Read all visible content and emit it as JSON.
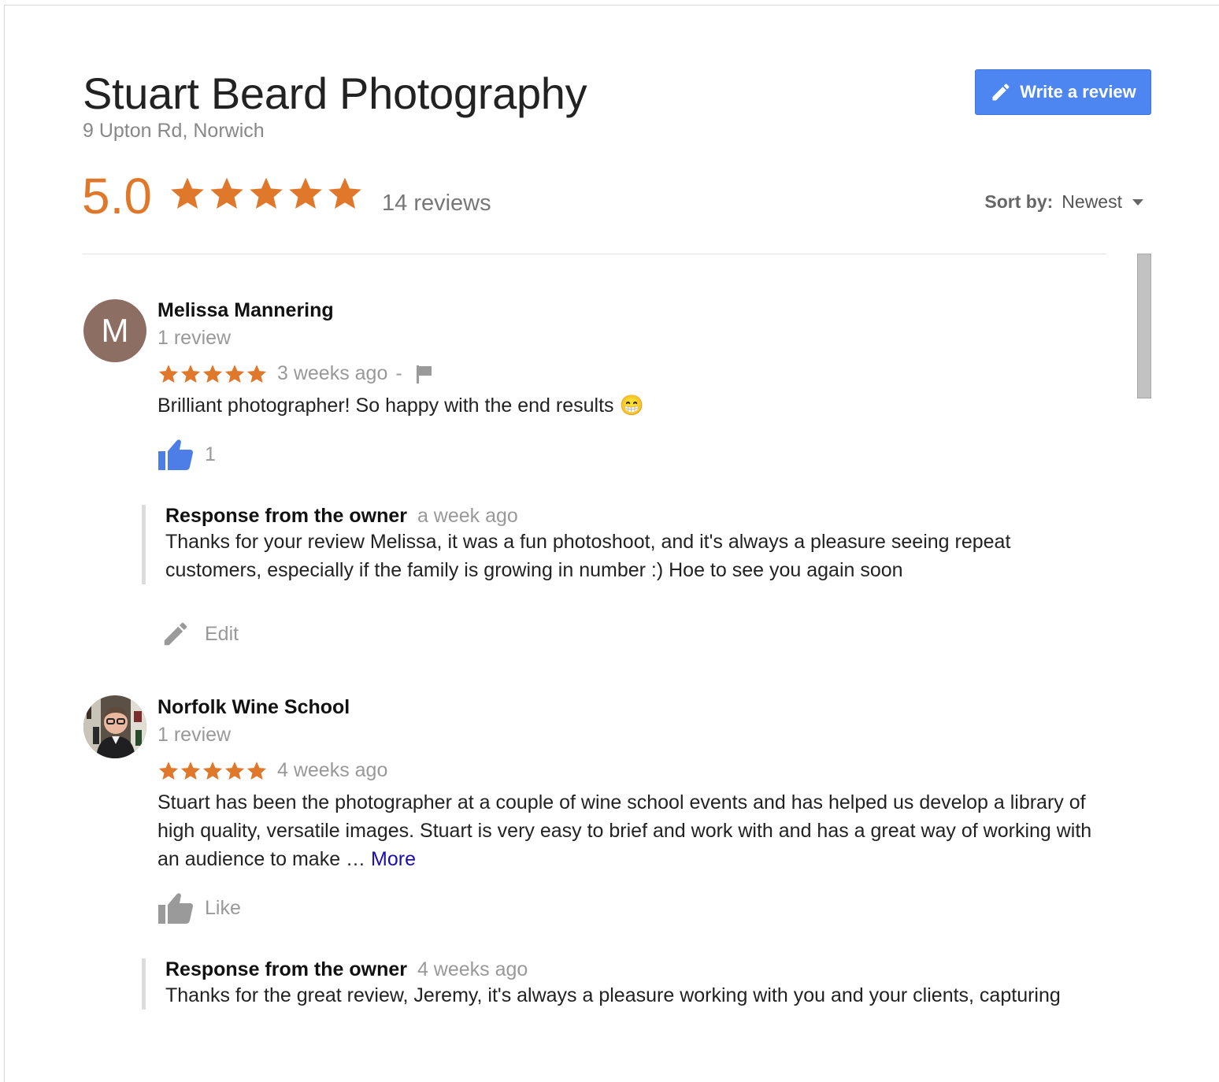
{
  "business": {
    "name": "Stuart Beard Photography",
    "address": "9 Upton Rd, Norwich"
  },
  "actions": {
    "write_review": "Write a review"
  },
  "summary": {
    "score": "5.0",
    "stars": 5,
    "review_count": "14 reviews"
  },
  "sort": {
    "label": "Sort by:",
    "value": "Newest"
  },
  "colors": {
    "star": "#e0782c",
    "accent": "#4d86f0",
    "link": "#1a0dab"
  },
  "reviews": [
    {
      "avatar_letter": "M",
      "author": "Melissa Mannering",
      "author_reviews": "1 review",
      "stars": 5,
      "time": "3 weeks ago",
      "separator": "-",
      "text": "Brilliant photographer! So happy with the end results 😁",
      "likes": "1",
      "owner_response": {
        "label": "Response from the owner",
        "time": "a week ago",
        "text": "Thanks for your review Melissa, it was a fun photoshoot, and it's always a pleasure seeing repeat customers, especially if the family is growing in number :) Hoe to see you again soon"
      },
      "edit_label": "Edit"
    },
    {
      "author": "Norfolk Wine School",
      "author_reviews": "1 review",
      "stars": 5,
      "time": "4 weeks ago",
      "text": "Stuart has been the photographer at a couple of wine school events and has helped us develop a library of high quality, versatile images. Stuart is very easy to brief and work with and has a great way of working with an audience to make …",
      "more_label": "More",
      "like_label": "Like",
      "owner_response": {
        "label": "Response from the owner",
        "time": "4 weeks ago",
        "text": "Thanks for the great review, Jeremy, it's always a pleasure working with you and your clients, capturing"
      }
    }
  ]
}
